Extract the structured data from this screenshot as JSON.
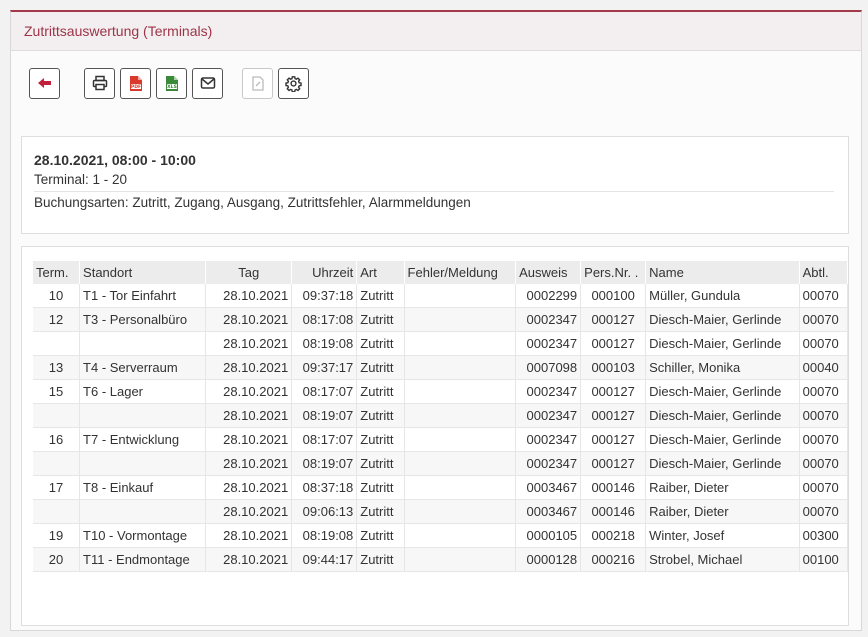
{
  "window": {
    "title": "Zutrittsauswertung (Terminals)"
  },
  "toolbar": {
    "buttons": [
      {
        "name": "back-button",
        "icon": "arrow-left-icon"
      },
      {
        "name": "print-button",
        "icon": "printer-icon"
      },
      {
        "name": "pdf-export-button",
        "icon": "pdf-icon"
      },
      {
        "name": "xls-export-button",
        "icon": "xls-icon"
      },
      {
        "name": "email-button",
        "icon": "envelope-icon"
      },
      {
        "name": "document-button",
        "icon": "document-icon",
        "disabled": true
      },
      {
        "name": "settings-button",
        "icon": "gear-icon"
      }
    ],
    "colors": {
      "accent": "#c0203a",
      "pdf": "#d93a2b",
      "xls": "#3a8a3a"
    }
  },
  "info": {
    "date_range": "28.10.2021, 08:00 - 10:00",
    "terminal": "Terminal: 1 - 20",
    "booking_types": "Buchungsarten: Zutritt, Zugang, Ausgang, Zutrittsfehler, Alarmmeldungen"
  },
  "table": {
    "headers": [
      "Term.",
      "Standort",
      "Tag",
      "Uhrzeit",
      "Art",
      "Fehler/Meldung",
      "Ausweis",
      "Pers.Nr. .",
      "Name",
      "Abtl."
    ],
    "rows": [
      [
        "10",
        "T1 - Tor Einfahrt",
        "28.10.2021",
        "09:37:18",
        "Zutritt",
        "",
        "0002299",
        "000100",
        "Müller, Gundula",
        "00070"
      ],
      [
        "12",
        "T3 - Personalbüro",
        "28.10.2021",
        "08:17:08",
        "Zutritt",
        "",
        "0002347",
        "000127",
        "Diesch-Maier, Gerlinde",
        "00070"
      ],
      [
        "",
        "",
        "28.10.2021",
        "08:19:08",
        "Zutritt",
        "",
        "0002347",
        "000127",
        "Diesch-Maier, Gerlinde",
        "00070"
      ],
      [
        "13",
        "T4 - Serverraum",
        "28.10.2021",
        "09:37:17",
        "Zutritt",
        "",
        "0007098",
        "000103",
        "Schiller, Monika",
        "00040"
      ],
      [
        "15",
        "T6 - Lager",
        "28.10.2021",
        "08:17:07",
        "Zutritt",
        "",
        "0002347",
        "000127",
        "Diesch-Maier, Gerlinde",
        "00070"
      ],
      [
        "",
        "",
        "28.10.2021",
        "08:19:07",
        "Zutritt",
        "",
        "0002347",
        "000127",
        "Diesch-Maier, Gerlinde",
        "00070"
      ],
      [
        "16",
        "T7 - Entwicklung",
        "28.10.2021",
        "08:17:07",
        "Zutritt",
        "",
        "0002347",
        "000127",
        "Diesch-Maier, Gerlinde",
        "00070"
      ],
      [
        "",
        "",
        "28.10.2021",
        "08:19:07",
        "Zutritt",
        "",
        "0002347",
        "000127",
        "Diesch-Maier, Gerlinde",
        "00070"
      ],
      [
        "17",
        "T8 - Einkauf",
        "28.10.2021",
        "08:37:18",
        "Zutritt",
        "",
        "0003467",
        "000146",
        "Raiber, Dieter",
        "00070"
      ],
      [
        "",
        "",
        "28.10.2021",
        "09:06:13",
        "Zutritt",
        "",
        "0003467",
        "000146",
        "Raiber, Dieter",
        "00070"
      ],
      [
        "19",
        "T10 - Vormontage",
        "28.10.2021",
        "08:19:08",
        "Zutritt",
        "",
        "0000105",
        "000218",
        "Winter, Josef",
        "00300"
      ],
      [
        "20",
        "T11 - Endmontage",
        "28.10.2021",
        "09:44:17",
        "Zutritt",
        "",
        "0000128",
        "000216",
        "Strobel, Michael",
        "00100"
      ]
    ]
  }
}
